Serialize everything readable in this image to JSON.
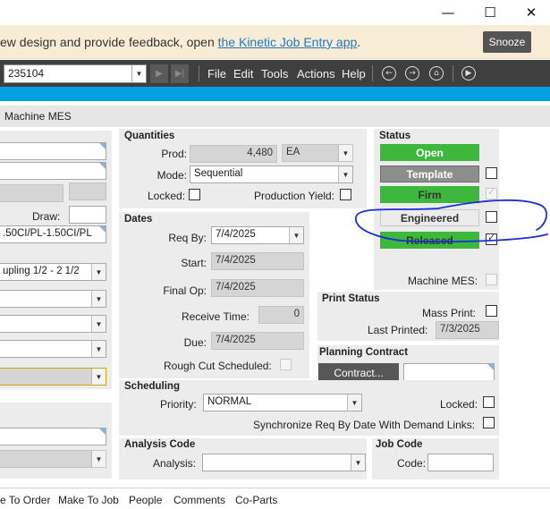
{
  "window": {
    "minimize": "—",
    "maximize": "☐",
    "close": "✕"
  },
  "banner": {
    "text": "ew design and provide feedback, open ",
    "link": "the Kinetic Job Entry app",
    "suffix": ".",
    "snooze": "Snooze"
  },
  "toolbar": {
    "job_number": "235104",
    "menus": [
      "File",
      "Edit",
      "Tools",
      "Actions",
      "Help"
    ],
    "icons": [
      "back-icon",
      "forward-icon",
      "home-icon",
      "play-icon"
    ]
  },
  "tab_header": "Machine MES",
  "left": {
    "draw_label": "Draw:",
    "part_desc": ".50CI/PL-1.50CI/PL",
    "coupling": "upling 1/2 - 2 1/2"
  },
  "quantities": {
    "title": "Quantities",
    "prod_label": "Prod:",
    "prod_value": "4,480",
    "uom": "EA",
    "mode_label": "Mode:",
    "mode_value": "Sequential",
    "locked_label": "Locked:",
    "yield_label": "Production Yield:"
  },
  "dates": {
    "title": "Dates",
    "reqby_label": "Req By:",
    "reqby_value": "7/4/2025",
    "start_label": "Start:",
    "start_value": "7/4/2025",
    "finalop_label": "Final Op:",
    "finalop_value": "7/4/2025",
    "receive_label": "Receive Time:",
    "receive_value": "0",
    "due_label": "Due:",
    "due_value": "7/4/2025",
    "roughcut_label": "Rough Cut Scheduled:"
  },
  "status": {
    "title": "Status",
    "open": "Open",
    "template": "Template",
    "firm": "Firm",
    "engineered": "Engineered",
    "released": "Released",
    "machine_mes_label": "Machine MES:"
  },
  "print_status": {
    "title": "Print Status",
    "mass_print_label": "Mass Print:",
    "last_printed_label": "Last Printed:",
    "last_printed_value": "7/3/2025"
  },
  "planning_contract": {
    "title": "Planning Contract",
    "contract_button": "Contract..."
  },
  "scheduling": {
    "title": "Scheduling",
    "priority_label": "Priority:",
    "priority_value": "NORMAL",
    "locked_label": "Locked:",
    "sync_label": "Synchronize Req By Date With Demand Links:"
  },
  "analysis_code": {
    "title": "Analysis Code",
    "analysis_label": "Analysis:"
  },
  "job_code": {
    "title": "Job Code",
    "code_label": "Code:"
  },
  "bottom_tabs": [
    "e To Order",
    "Make To Job",
    "People",
    "Comments",
    "Co-Parts"
  ],
  "colors": {
    "accent_blue": "#00a0e3",
    "status_green": "#3db83d",
    "toolbar": "#3f3f3f",
    "annotation": "#1a2fd6"
  }
}
